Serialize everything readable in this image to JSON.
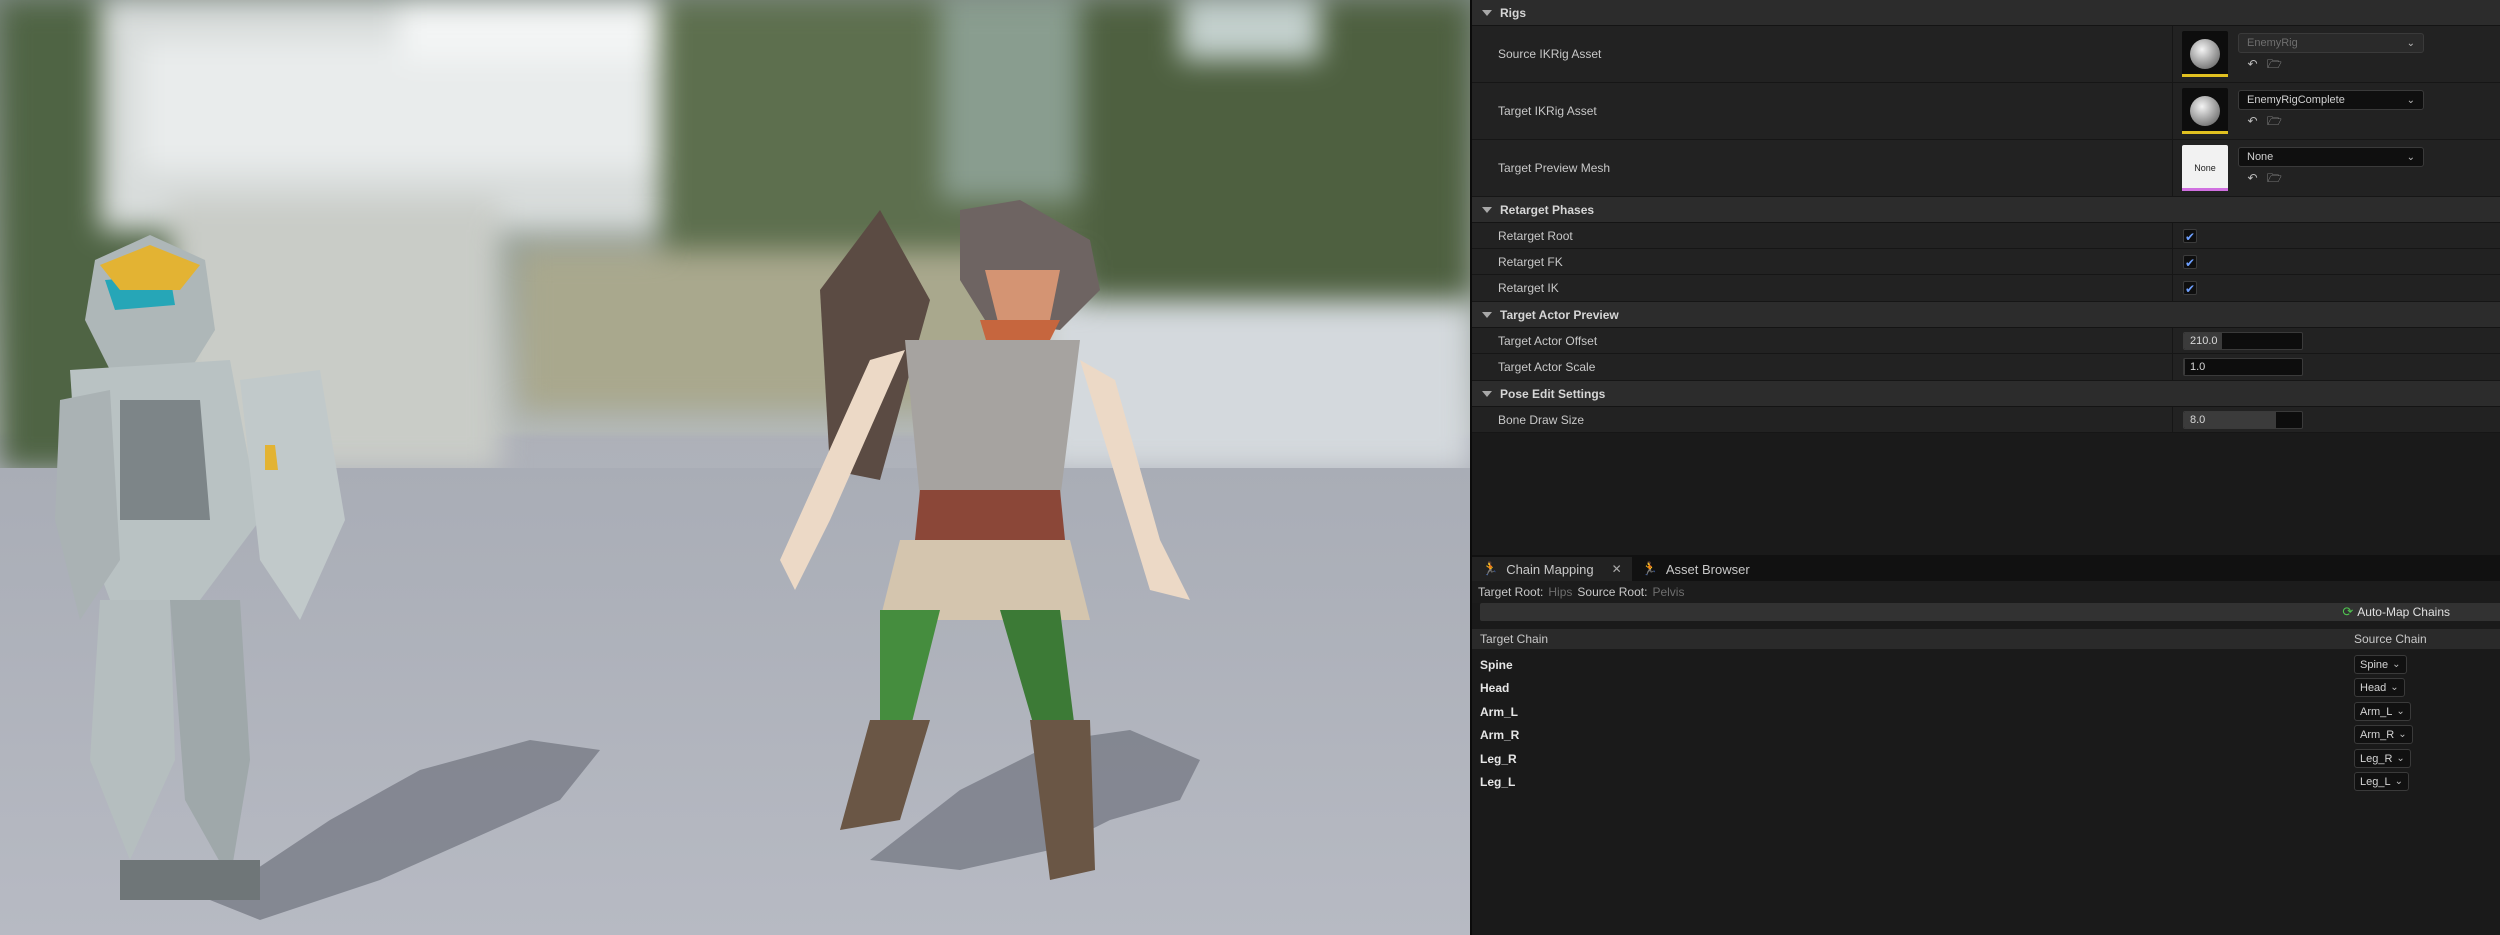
{
  "rigs_section": {
    "title": "Rigs",
    "source_ikrig": {
      "label": "Source IKRig Asset",
      "value": "EnemyRig",
      "bar_color": "#e0c020"
    },
    "target_ikrig": {
      "label": "Target IKRig Asset",
      "value": "EnemyRigComplete",
      "bar_color": "#e0c020"
    },
    "preview_mesh": {
      "label": "Target Preview Mesh",
      "value": "None",
      "thumb_text": "None",
      "bar_color": "#d070e0"
    }
  },
  "retarget_phases": {
    "title": "Retarget Phases",
    "items": [
      {
        "label": "Retarget Root",
        "checked": "✔"
      },
      {
        "label": "Retarget FK",
        "checked": "✔"
      },
      {
        "label": "Retarget IK",
        "checked": "✔"
      }
    ]
  },
  "target_actor_preview": {
    "title": "Target Actor Preview",
    "offset": {
      "label": "Target Actor Offset",
      "value": "210.0",
      "level": 0.32
    },
    "scale": {
      "label": "Target Actor Scale",
      "value": "1.0",
      "level": 0.01
    }
  },
  "pose_edit": {
    "title": "Pose Edit Settings",
    "bone_draw": {
      "label": "Bone Draw Size",
      "value": "8.0",
      "level": 0.78
    }
  },
  "tabs": [
    {
      "label": "Chain Mapping",
      "active": true
    },
    {
      "label": "Asset Browser",
      "active": false
    }
  ],
  "roots": {
    "target_label": "Target Root:",
    "target_value": "Hips",
    "source_label": "Source Root:",
    "source_value": "Pelvis"
  },
  "automap_label": "Auto-Map Chains",
  "table": {
    "col_target": "Target Chain",
    "col_source": "Source Chain",
    "rows": [
      {
        "target": "Spine",
        "source": "Spine"
      },
      {
        "target": "Head",
        "source": "Head"
      },
      {
        "target": "Arm_L",
        "source": "Arm_L"
      },
      {
        "target": "Arm_R",
        "source": "Arm_R"
      },
      {
        "target": "Leg_R",
        "source": "Leg_R"
      },
      {
        "target": "Leg_L",
        "source": "Leg_L"
      }
    ]
  },
  "icons": {
    "browse": "browse-asset-icon",
    "reset": "reset-arrow-icon",
    "chevron": "chevron-down-icon",
    "refresh": "refresh-icon",
    "close": "close-icon"
  }
}
